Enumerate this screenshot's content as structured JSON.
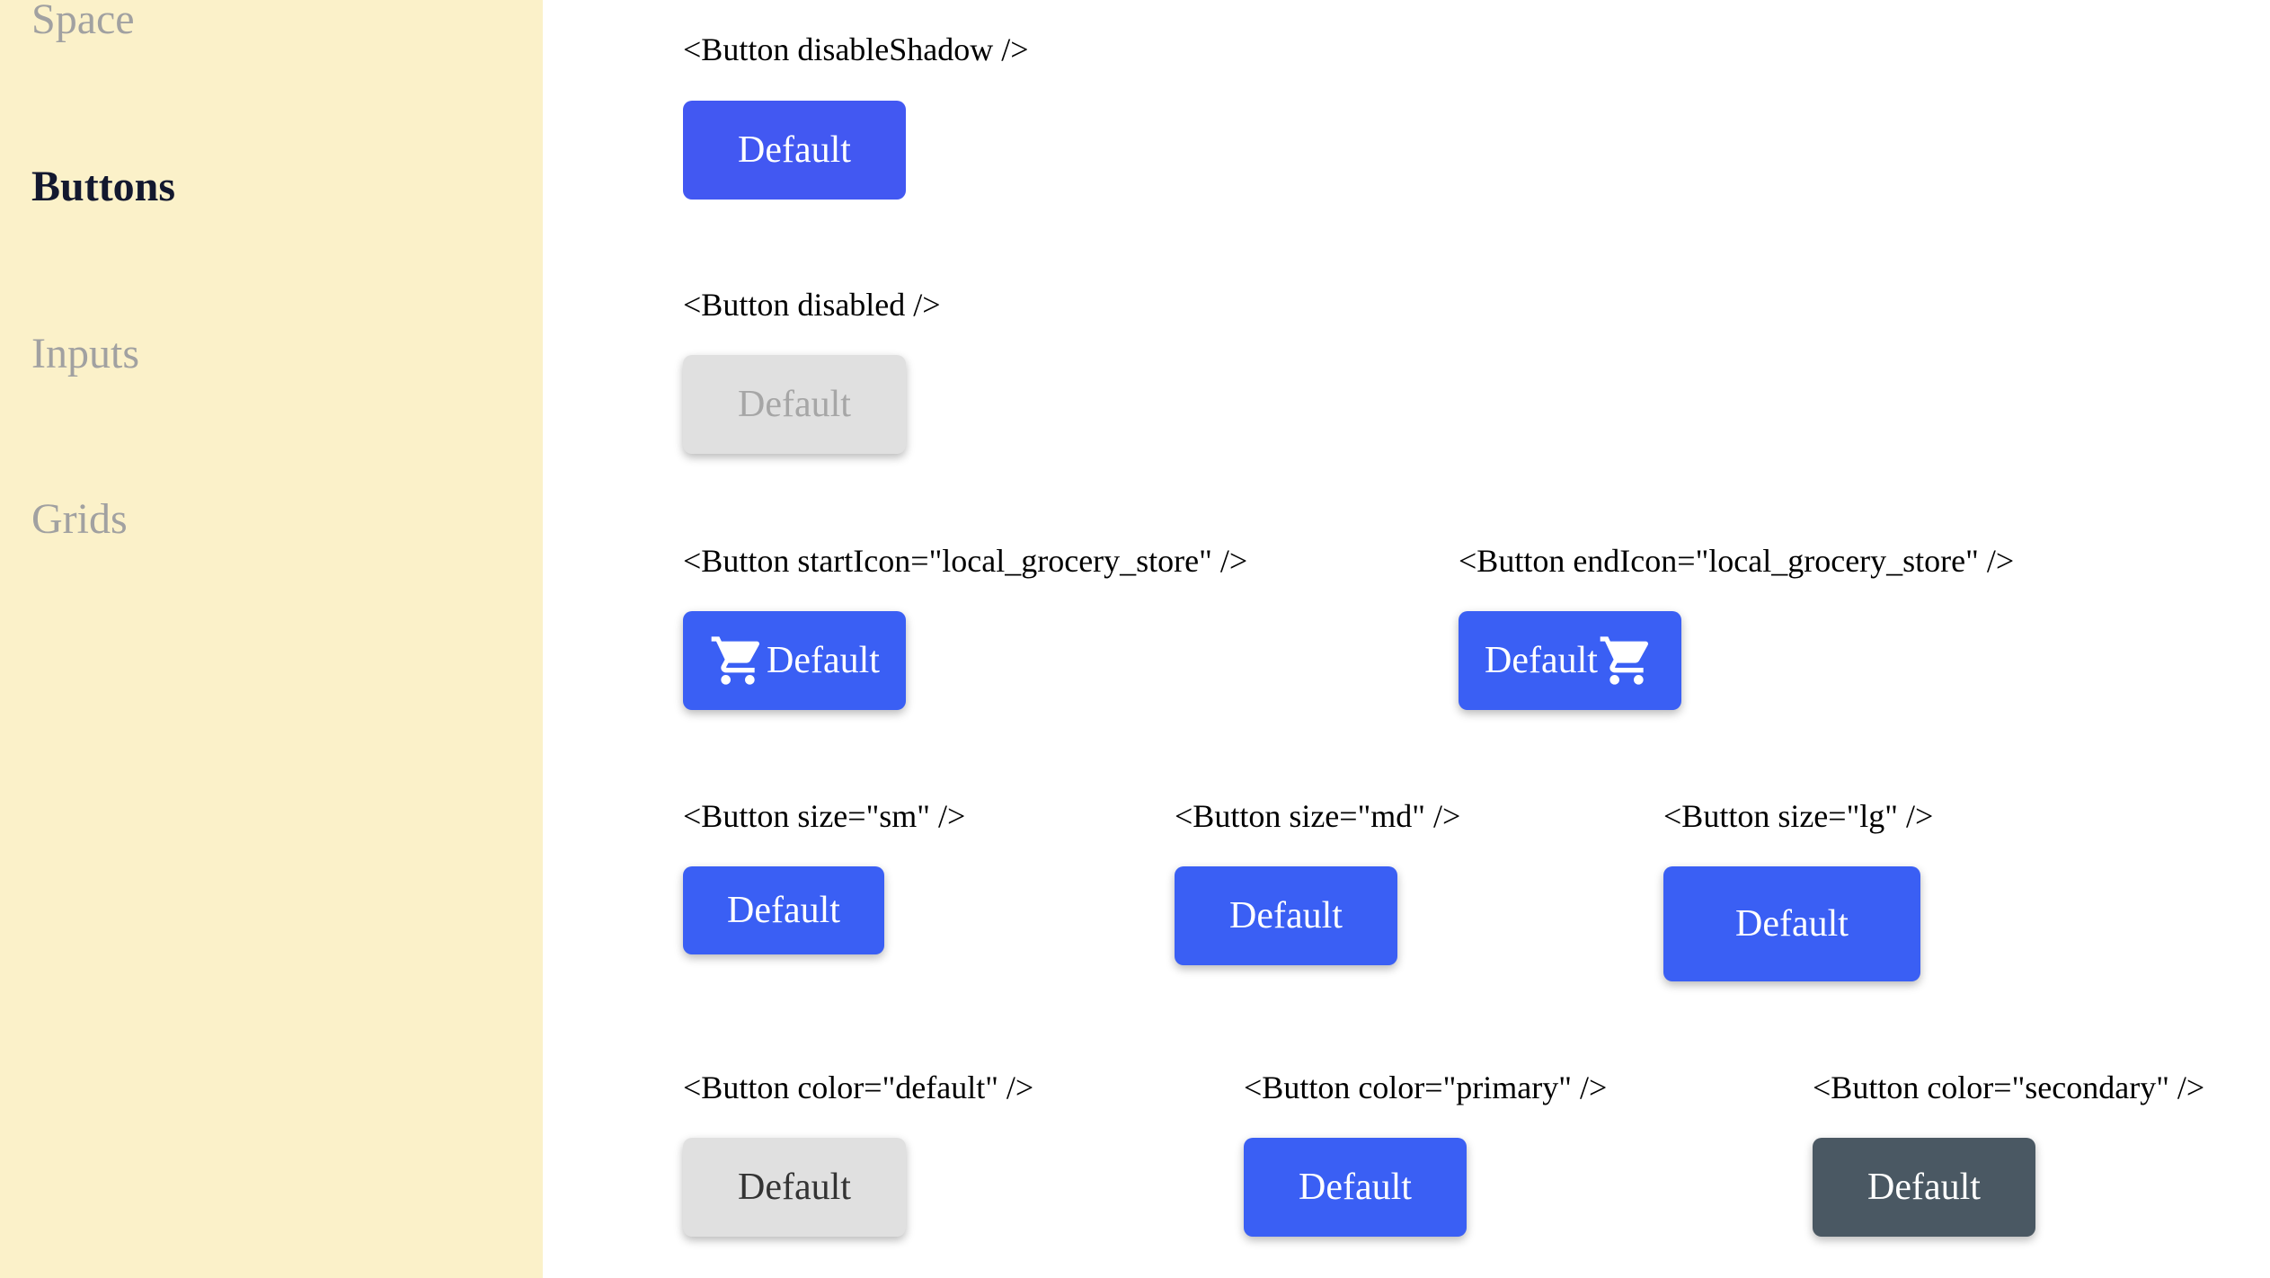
{
  "sidebar": {
    "items": [
      {
        "label": "Space"
      },
      {
        "label": "Buttons"
      },
      {
        "label": "Inputs"
      },
      {
        "label": "Grids"
      }
    ]
  },
  "demos": {
    "disable_shadow": {
      "caption": "<Button disableShadow />",
      "label": "Default"
    },
    "disabled": {
      "caption": "<Button disabled />",
      "label": "Default"
    },
    "start_icon": {
      "caption": "<Button startIcon=\"local_grocery_store\" />",
      "label": "Default",
      "icon": "shopping-cart-icon"
    },
    "end_icon": {
      "caption": "<Button endIcon=\"local_grocery_store\" />",
      "label": "Default",
      "icon": "shopping-cart-icon"
    },
    "size_sm": {
      "caption": "<Button size=\"sm\" />",
      "label": "Default"
    },
    "size_md": {
      "caption": "<Button size=\"md\" />",
      "label": "Default"
    },
    "size_lg": {
      "caption": "<Button size=\"lg\" />",
      "label": "Default"
    },
    "color_default": {
      "caption": "<Button color=\"default\" />",
      "label": "Default"
    },
    "color_primary": {
      "caption": "<Button color=\"primary\" />",
      "label": "Default"
    },
    "color_secondary": {
      "caption": "<Button color=\"secondary\" />",
      "label": "Default"
    }
  },
  "colors": {
    "sidebar_bg": "#fbf1c9",
    "primary": "#3a5ff4",
    "secondary": "#4a5863",
    "default_grey": "#e0e0e0",
    "nav_active": "#13182f",
    "nav_inactive": "#a1a1a1"
  }
}
